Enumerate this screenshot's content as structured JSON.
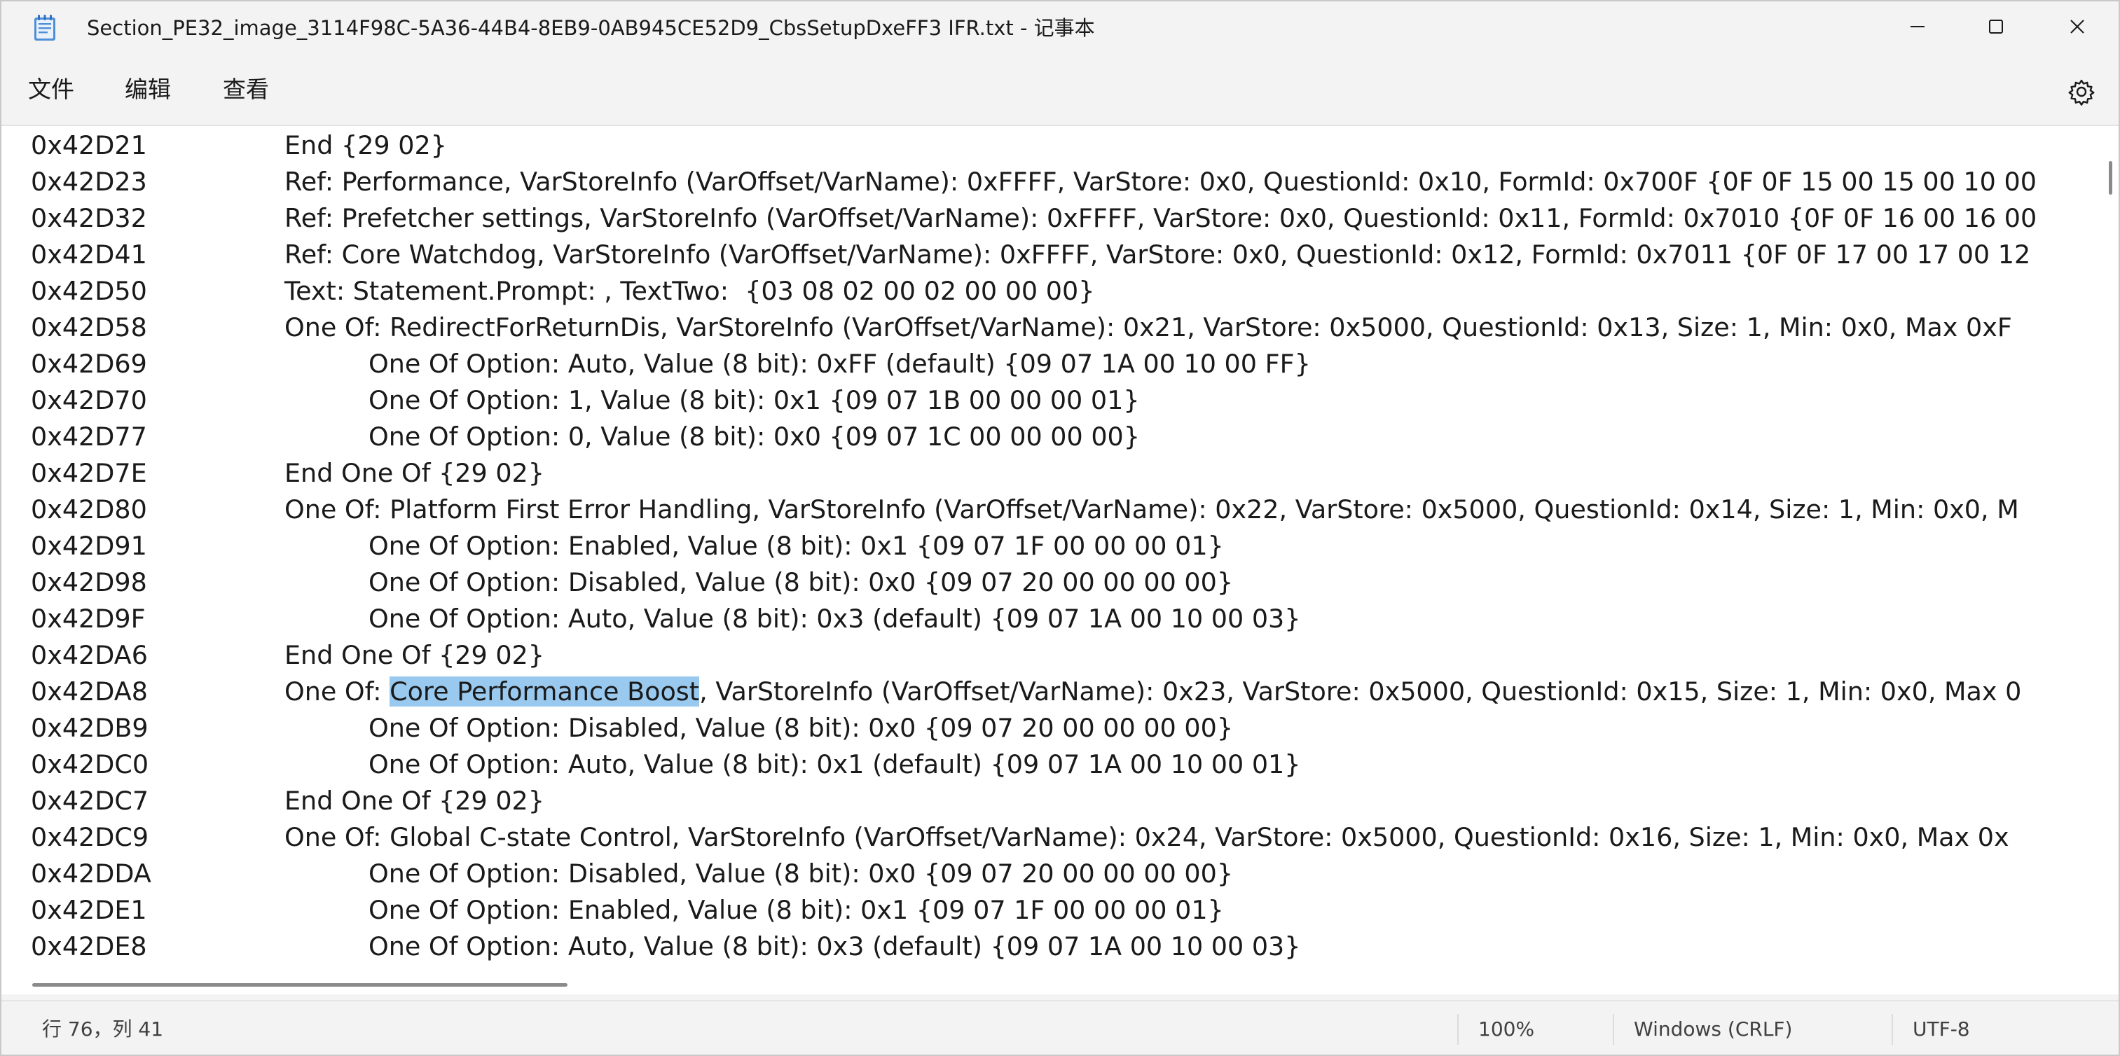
{
  "window": {
    "title": "Section_PE32_image_3114F98C-5A36-44B4-8EB9-0AB945CE52D9_CbsSetupDxeFF3 IFR.txt - 记事本",
    "app_icon": "notepad-icon"
  },
  "menu": {
    "file": "文件",
    "edit": "编辑",
    "view": "查看"
  },
  "icons": {
    "settings": "gear-icon",
    "minimize": "minimize-icon",
    "maximize": "maximize-icon",
    "close": "close-icon"
  },
  "colors": {
    "selection": "#99c9ef",
    "window_bg": "#f3f3f3",
    "editor_bg": "#ffffff"
  },
  "editor": {
    "selected_text": "Core Performance Boost",
    "lines": [
      {
        "addr": "0x42D21",
        "indent": 1,
        "text": "End {29 02}"
      },
      {
        "addr": "0x42D23",
        "indent": 1,
        "text": "Ref: Performance, VarStoreInfo (VarOffset/VarName): 0xFFFF, VarStore: 0x0, QuestionId: 0x10, FormId: 0x700F {0F 0F 15 00 15 00 10 00"
      },
      {
        "addr": "0x42D32",
        "indent": 1,
        "text": "Ref: Prefetcher settings, VarStoreInfo (VarOffset/VarName): 0xFFFF, VarStore: 0x0, QuestionId: 0x11, FormId: 0x7010 {0F 0F 16 00 16 00"
      },
      {
        "addr": "0x42D41",
        "indent": 1,
        "text": "Ref: Core Watchdog, VarStoreInfo (VarOffset/VarName): 0xFFFF, VarStore: 0x0, QuestionId: 0x12, FormId: 0x7011 {0F 0F 17 00 17 00 12"
      },
      {
        "addr": "0x42D50",
        "indent": 1,
        "text": "Text: Statement.Prompt: , TextTwo:  {03 08 02 00 02 00 00 00}"
      },
      {
        "addr": "0x42D58",
        "indent": 1,
        "text": "One Of: RedirectForReturnDis, VarStoreInfo (VarOffset/VarName): 0x21, VarStore: 0x5000, QuestionId: 0x13, Size: 1, Min: 0x0, Max 0xF"
      },
      {
        "addr": "0x42D69",
        "indent": 2,
        "text": "One Of Option: Auto, Value (8 bit): 0xFF (default) {09 07 1A 00 10 00 FF}"
      },
      {
        "addr": "0x42D70",
        "indent": 2,
        "text": "One Of Option: 1, Value (8 bit): 0x1 {09 07 1B 00 00 00 01}"
      },
      {
        "addr": "0x42D77",
        "indent": 2,
        "text": "One Of Option: 0, Value (8 bit): 0x0 {09 07 1C 00 00 00 00}"
      },
      {
        "addr": "0x42D7E",
        "indent": 1,
        "text": "End One Of {29 02}"
      },
      {
        "addr": "0x42D80",
        "indent": 1,
        "text": "One Of: Platform First Error Handling, VarStoreInfo (VarOffset/VarName): 0x22, VarStore: 0x5000, QuestionId: 0x14, Size: 1, Min: 0x0, M"
      },
      {
        "addr": "0x42D91",
        "indent": 2,
        "text": "One Of Option: Enabled, Value (8 bit): 0x1 {09 07 1F 00 00 00 01}"
      },
      {
        "addr": "0x42D98",
        "indent": 2,
        "text": "One Of Option: Disabled, Value (8 bit): 0x0 {09 07 20 00 00 00 00}"
      },
      {
        "addr": "0x42D9F",
        "indent": 2,
        "text": "One Of Option: Auto, Value (8 bit): 0x3 (default) {09 07 1A 00 10 00 03}"
      },
      {
        "addr": "0x42DA6",
        "indent": 1,
        "text": "End One Of {29 02}"
      },
      {
        "addr": "0x42DA8",
        "indent": 1,
        "pre": "One Of: ",
        "hl": "Core Performance Boost",
        "post": ", VarStoreInfo (VarOffset/VarName): 0x23, VarStore: 0x5000, QuestionId: 0x15, Size: 1, Min: 0x0, Max 0"
      },
      {
        "addr": "0x42DB9",
        "indent": 2,
        "text": "One Of Option: Disabled, Value (8 bit): 0x0 {09 07 20 00 00 00 00}"
      },
      {
        "addr": "0x42DC0",
        "indent": 2,
        "text": "One Of Option: Auto, Value (8 bit): 0x1 (default) {09 07 1A 00 10 00 01}"
      },
      {
        "addr": "0x42DC7",
        "indent": 1,
        "text": "End One Of {29 02}"
      },
      {
        "addr": "0x42DC9",
        "indent": 1,
        "text": "One Of: Global C-state Control, VarStoreInfo (VarOffset/VarName): 0x24, VarStore: 0x5000, QuestionId: 0x16, Size: 1, Min: 0x0, Max 0x"
      },
      {
        "addr": "0x42DDA",
        "indent": 2,
        "text": "One Of Option: Disabled, Value (8 bit): 0x0 {09 07 20 00 00 00 00}"
      },
      {
        "addr": "0x42DE1",
        "indent": 2,
        "text": "One Of Option: Enabled, Value (8 bit): 0x1 {09 07 1F 00 00 00 01}"
      },
      {
        "addr": "0x42DE8",
        "indent": 2,
        "text": "One Of Option: Auto, Value (8 bit): 0x3 (default) {09 07 1A 00 10 00 03}"
      }
    ]
  },
  "status": {
    "position": "行 76，列 41",
    "zoom": "100%",
    "line_ending": "Windows (CRLF)",
    "encoding": "UTF-8"
  }
}
